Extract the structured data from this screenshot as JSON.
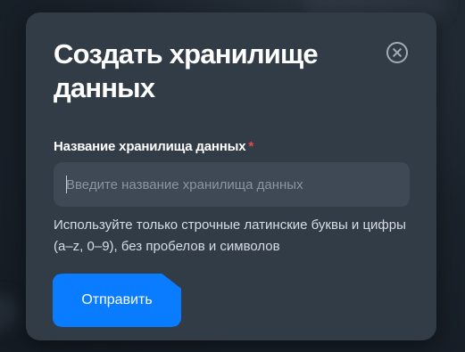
{
  "modal": {
    "title": "Создать хранилище данных",
    "field_label": "Название хранилища данных",
    "required_mark": "*",
    "input_placeholder": "Введите название хранилища данных",
    "input_value": "",
    "hint": "Используйте только строчные латинские буквы и цифры (a–z, 0–9), без пробелов и символов",
    "submit_label": "Отправить"
  },
  "icons": {
    "close": "close-circle-icon"
  },
  "colors": {
    "modal_bg": "#323c47",
    "input_bg": "#3f4956",
    "accent": "#0a7cff",
    "required": "#e5484d"
  }
}
